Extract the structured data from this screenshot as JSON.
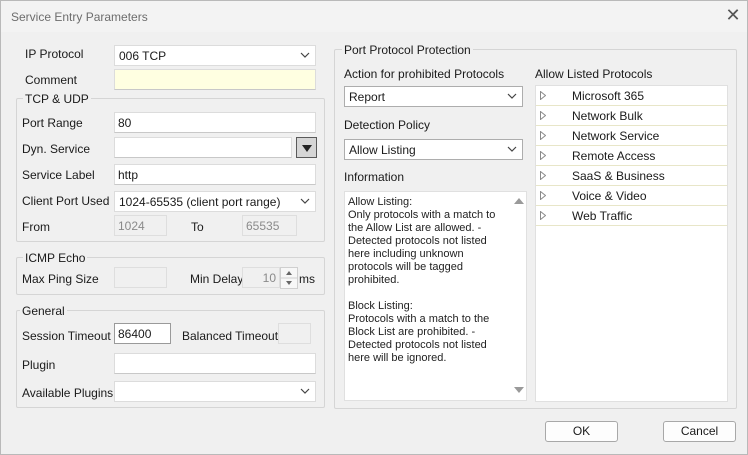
{
  "window": {
    "title": "Service Entry Parameters"
  },
  "left": {
    "ip_protocol": {
      "label": "IP Protocol",
      "value": "006 TCP"
    },
    "comment": {
      "label": "Comment",
      "value": ""
    },
    "tcp_udp": {
      "title": "TCP & UDP",
      "port_range": {
        "label": "Port Range",
        "value": "80"
      },
      "dyn_service": {
        "label": "Dyn. Service",
        "value": ""
      },
      "service_label": {
        "label": "Service Label",
        "value": "http"
      },
      "client_port_used": {
        "label": "Client Port Used",
        "value": "1024-65535 (client port range)"
      },
      "from": {
        "label": "From",
        "value": "1024"
      },
      "to": {
        "label": "To",
        "value": "65535"
      }
    },
    "icmp_echo": {
      "title": "ICMP Echo",
      "max_ping_size": {
        "label": "Max Ping Size",
        "value": ""
      },
      "min_delay": {
        "label": "Min Delay",
        "value": "10",
        "unit": "ms"
      }
    },
    "general": {
      "title": "General",
      "session_timeout": {
        "label": "Session Timeout",
        "value": "86400"
      },
      "balanced_timeout": {
        "label": "Balanced Timeout",
        "value": ""
      },
      "plugin": {
        "label": "Plugin",
        "value": ""
      },
      "available_plugins": {
        "label": "Available Plugins",
        "value": ""
      }
    }
  },
  "right": {
    "title": "Port Protocol Protection",
    "action": {
      "label": "Action for prohibited Protocols",
      "value": "Report"
    },
    "detection": {
      "label": "Detection Policy",
      "value": "Allow Listing"
    },
    "information": {
      "label": "Information",
      "text": "Allow Listing:\nOnly protocols with a match to the Allow List are allowed. - Detected protocols not listed here including unknown protocols will be tagged prohibited.\n\nBlock Listing:\nProtocols with a match to the Block List are prohibited. - Detected protocols not listed here will be ignored."
    },
    "allow_listed": {
      "label": "Allow Listed Protocols",
      "items": [
        "Microsoft 365",
        "Network Bulk",
        "Network Service",
        "Remote Access",
        "SaaS & Business",
        "Voice & Video",
        "Web Traffic"
      ]
    }
  },
  "buttons": {
    "ok": "OK",
    "cancel": "Cancel"
  },
  "icons": {
    "close": "close-icon",
    "chevron": "chevron-down-icon",
    "expand": "triangle-right-icon"
  }
}
